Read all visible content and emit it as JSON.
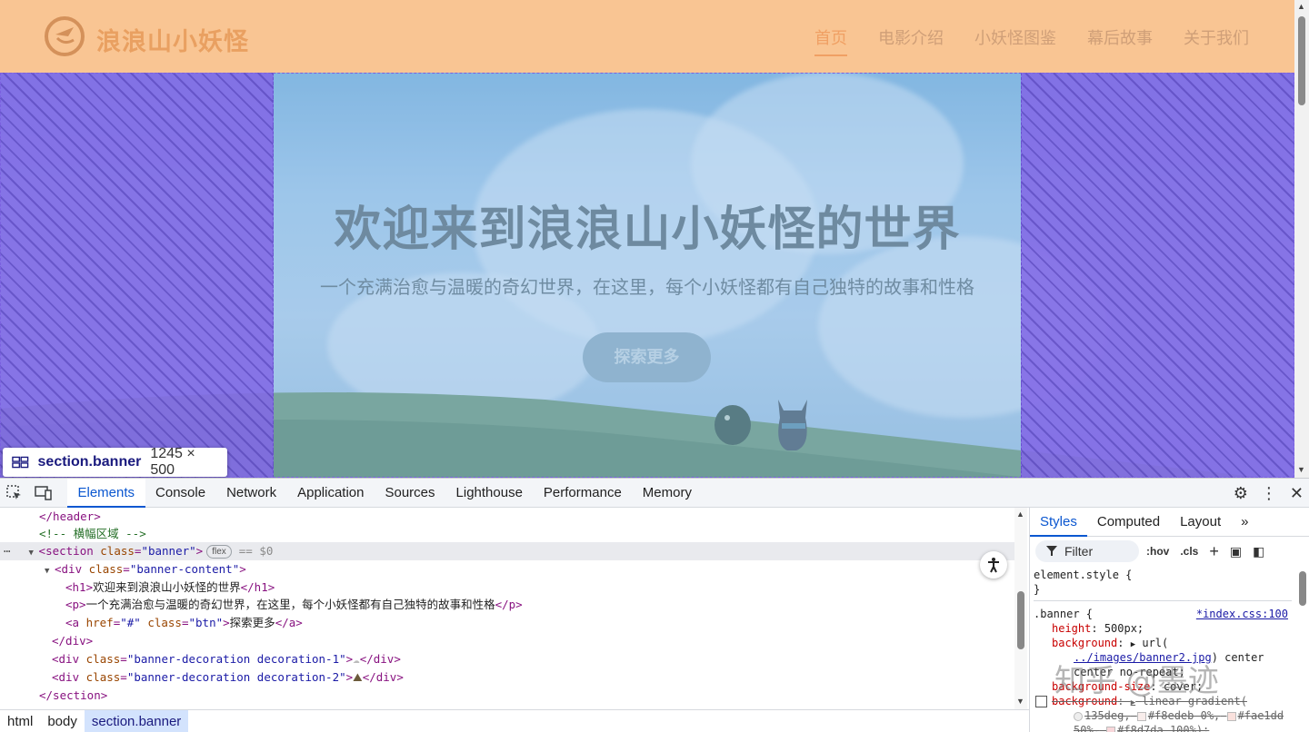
{
  "site": {
    "logo_text": "浪浪山小妖怪",
    "nav": [
      "首页",
      "电影介绍",
      "小妖怪图鉴",
      "幕后故事",
      "关于我们"
    ],
    "banner_title": "欢迎来到浪浪山小妖怪的世界",
    "banner_subtitle": "一个充满治愈与温暖的奇幻世界，在这里，每个小妖怪都有自己独特的故事和性格",
    "banner_button": "探索更多"
  },
  "inspect_tooltip": {
    "name": "section.banner",
    "dims": "1245 × 500"
  },
  "devtools": {
    "tabs": [
      "Elements",
      "Console",
      "Network",
      "Application",
      "Sources",
      "Lighthouse",
      "Performance",
      "Memory"
    ],
    "active_tab": "Elements",
    "dom": {
      "l1": "</header>",
      "l2": "<!-- 横幅区域 -->",
      "l3_open": "<section class=\"banner\">",
      "l3_tag": "section",
      "l3_attr": "class",
      "l3_val": "\"banner\"",
      "l3_chip": "flex",
      "l3_dollar": "== $0",
      "l4_tag": "div",
      "l4_attr": "class",
      "l4_val": "\"banner-content\"",
      "h1_text": "欢迎来到浪浪山小妖怪的世界",
      "p_text": "一个充满治愈与温暖的奇幻世界，在这里，每个小妖怪都有自己独特的故事和性格",
      "a_href": "\"#\"",
      "a_class": "\"btn\"",
      "a_text": "探索更多",
      "deco1_class": "\"banner-decoration decoration-1\"",
      "deco1_emoji": "☁",
      "deco2_class": "\"banner-decoration decoration-2\"",
      "deco2_emoji": "⛰"
    },
    "breadcrumbs": [
      "html",
      "body",
      "section.banner"
    ],
    "styles_tabs": [
      "Styles",
      "Computed",
      "Layout"
    ],
    "filter_placeholder": "Filter",
    "style_tools": [
      ":hov",
      ".cls"
    ],
    "styles": {
      "element_style": "element.style {",
      "element_close": "}",
      "selector": ".banner {",
      "source": "*index.css:100",
      "height_prop": "height",
      "height_val": "500px;",
      "bg_prop": "background",
      "bg_val": "url(",
      "bg_url": "../images/banner2.jpg",
      "bg_rest": "center",
      "bg_rest2": "center no-repeat;",
      "bgsize_prop": "background-size",
      "bgsize_val": "cover;",
      "bg2_prop": "background",
      "bg2_val": "linear-gradient(",
      "grad1": "135deg,",
      "grad2": "#f8edeb 0%,",
      "grad3": "#fae1dd",
      "grad4": "50%,",
      "grad5": "#f8d7da 100%);"
    },
    "watermark": "知乎 @墨迹"
  }
}
